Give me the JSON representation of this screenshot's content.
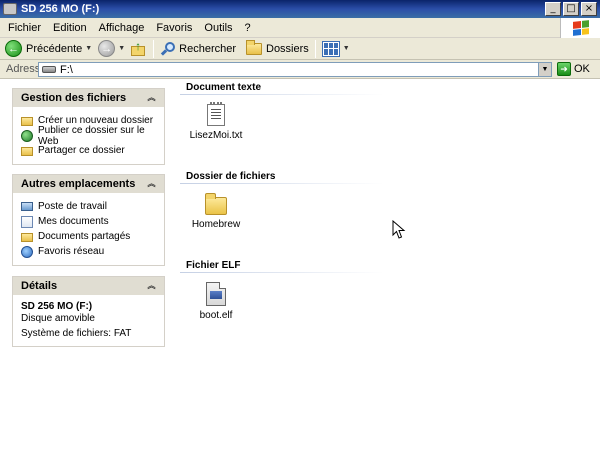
{
  "window": {
    "title": "SD 256 MO (F:)"
  },
  "menu": {
    "items": [
      "Fichier",
      "Edition",
      "Affichage",
      "Favoris",
      "Outils",
      "?"
    ]
  },
  "toolbar": {
    "back_label": "Précédente",
    "search_label": "Rechercher",
    "folders_label": "Dossiers"
  },
  "address": {
    "label": "Adresse",
    "value": "F:\\",
    "go_label": "OK"
  },
  "panels": {
    "file_tasks": {
      "title": "Gestion des fichiers",
      "items": [
        "Créer un nouveau dossier",
        "Publier ce dossier sur le Web",
        "Partager ce dossier"
      ]
    },
    "other_places": {
      "title": "Autres emplacements",
      "items": [
        "Poste de travail",
        "Mes documents",
        "Documents partagés",
        "Favoris réseau"
      ]
    },
    "details": {
      "title": "Détails",
      "name": "SD 256 MO (F:)",
      "type": "Disque amovible",
      "filesystem": "Système de fichiers: FAT"
    }
  },
  "groups": [
    {
      "title": "Document texte",
      "file": "LisezMoi.txt"
    },
    {
      "title": "Dossier de fichiers",
      "file": "Homebrew"
    },
    {
      "title": "Fichier ELF",
      "file": "boot.elf"
    }
  ],
  "colors": {
    "titlebar": "#0a246a",
    "chrome": "#ece9d8",
    "panel_header": "#e0ddd2"
  }
}
